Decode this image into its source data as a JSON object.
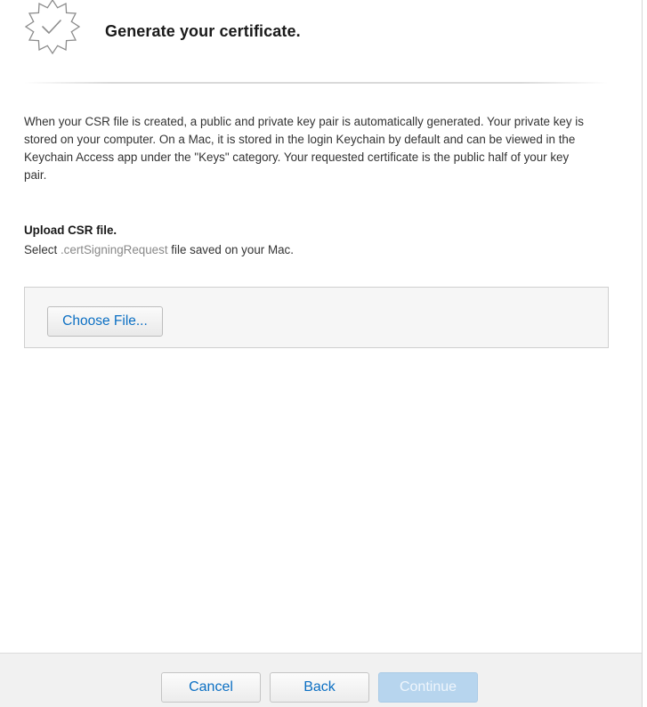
{
  "header": {
    "title": "Generate your certificate.",
    "icon": "certificate-badge-icon"
  },
  "description": "When your CSR file is created, a public and private key pair is automatically generated. Your private key is stored on your computer. On a Mac, it is stored in the login Keychain by default and can be viewed in the Keychain Access app under the \"Keys\" category. Your requested certificate is the public half of your key pair.",
  "upload": {
    "heading": "Upload CSR file.",
    "instructions_prefix": "Select",
    "file_extension": ".certSigningRequest",
    "instructions_suffix": "file saved on your Mac.",
    "choose_file_label": "Choose File..."
  },
  "footer": {
    "cancel_label": "Cancel",
    "back_label": "Back",
    "continue_label": "Continue",
    "continue_enabled": false
  },
  "colors": {
    "link_blue": "#0b6fc3",
    "disabled_button_bg": "#b7d5ee",
    "footer_bg": "#f1f1f1",
    "upload_box_bg": "#f6f6f6"
  }
}
